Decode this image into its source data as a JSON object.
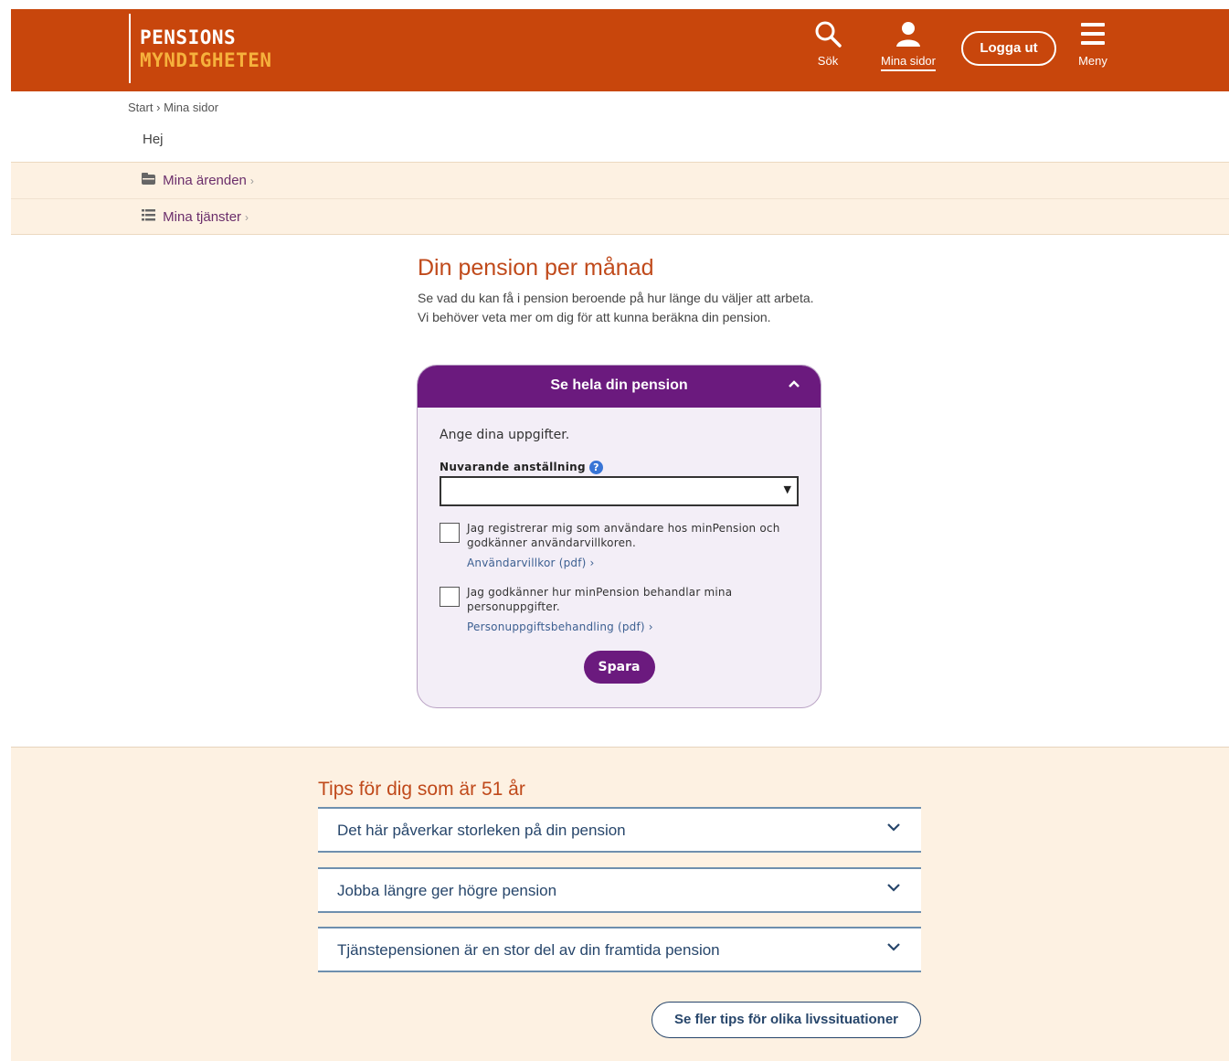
{
  "header": {
    "logo_line1": "PENSIONS",
    "logo_line2": "MYNDIGHETEN",
    "search_label": "Sök",
    "my_pages_label": "Mina sidor",
    "logout_label": "Logga ut",
    "menu_label": "Meny",
    "colors": {
      "background": "#c8460c",
      "logo_accent": "#f6b13c"
    }
  },
  "breadcrumb": {
    "start": "Start",
    "separator": "›",
    "current": "Mina sidor"
  },
  "greeting": "Hej",
  "nav": {
    "items": [
      {
        "icon": "folder-icon",
        "label": "Mina ärenden",
        "chevron": "›"
      },
      {
        "icon": "list-icon",
        "label": "Mina tjänster",
        "chevron": "›"
      }
    ]
  },
  "main": {
    "title": "Din pension per månad",
    "intro": "Se vad du kan få i pension beroende på hur länge du väljer att arbeta. Vi behöver veta mer om dig för att kunna beräkna din pension.",
    "card": {
      "header": "Se hela din pension",
      "prompt": "Ange dina uppgifter.",
      "field_label": "Nuvarande anställning",
      "select_value": "",
      "checkbox1_text": "Jag registrerar mig som användare hos minPension och godkänner användarvillkoren.",
      "checkbox1_link": "Användarvillkor (pdf) ›",
      "checkbox2_text": "Jag godkänner hur minPension behandlar mina personuppgifter.",
      "checkbox2_link": "Personuppgiftsbehandling (pdf) ›",
      "save_label": "Spara",
      "accent_color": "#6b1a7e"
    }
  },
  "tips": {
    "title": "Tips för dig som är 51 år",
    "items": [
      "Det här påverkar storleken på din pension",
      "Jobba längre ger högre pension",
      "Tjänstepensionen är en stor del av din framtida pension"
    ],
    "more_label": "Se fler tips för olika livssituationer"
  }
}
